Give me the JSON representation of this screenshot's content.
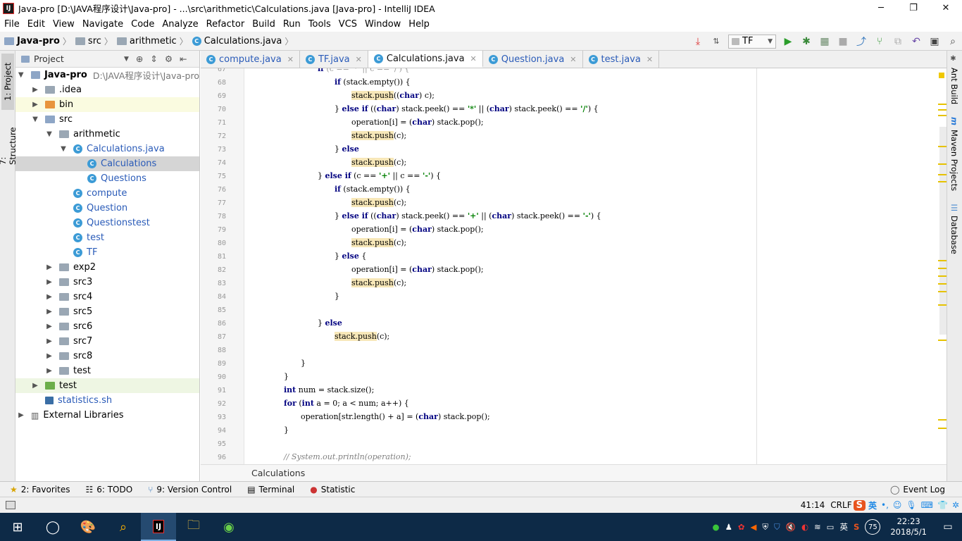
{
  "window": {
    "title": "Java-pro [D:\\JAVA程序设计\\Java-pro] - ...\\src\\arithmetic\\Calculations.java [Java-pro] - IntelliJ IDEA",
    "app_icon": "IJ",
    "min": "─",
    "max": "❐",
    "close": "✕"
  },
  "menu": [
    "File",
    "Edit",
    "View",
    "Navigate",
    "Code",
    "Analyze",
    "Refactor",
    "Build",
    "Run",
    "Tools",
    "VCS",
    "Window",
    "Help"
  ],
  "nav": {
    "crumbs": [
      "Java-pro",
      "src",
      "arithmetic",
      "Calculations.java"
    ],
    "run_config": "TF"
  },
  "left_strip": {
    "project": "1: Project",
    "structure": "7: Structure"
  },
  "right_strip": {
    "ant": "Ant Build",
    "maven": "Maven Projects",
    "database": "Database",
    "maven_icon": "m"
  },
  "project_panel": {
    "header": "Project",
    "tree": [
      {
        "label": "Java-pro",
        "path": "D:\\JAVA程序设计\\Java-pro",
        "arrow": "▼"
      },
      {
        "label": ".idea",
        "arrow": "▶"
      },
      {
        "label": "bin",
        "arrow": "▶"
      },
      {
        "label": "src",
        "arrow": "▼"
      },
      {
        "label": "arithmetic",
        "arrow": "▼"
      },
      {
        "label": "Calculations.java",
        "arrow": "▼"
      },
      {
        "label": "Calculations",
        "arrow": ""
      },
      {
        "label": "Questions",
        "arrow": ""
      },
      {
        "label": "compute",
        "arrow": ""
      },
      {
        "label": "Question",
        "arrow": ""
      },
      {
        "label": "Questionstest",
        "arrow": ""
      },
      {
        "label": "test",
        "arrow": ""
      },
      {
        "label": "TF",
        "arrow": ""
      },
      {
        "label": "exp2",
        "arrow": "▶"
      },
      {
        "label": "src3",
        "arrow": "▶"
      },
      {
        "label": "src4",
        "arrow": "▶"
      },
      {
        "label": "src5",
        "arrow": "▶"
      },
      {
        "label": "src6",
        "arrow": "▶"
      },
      {
        "label": "src7",
        "arrow": "▶"
      },
      {
        "label": "src8",
        "arrow": "▶"
      },
      {
        "label": "test",
        "arrow": "▶"
      },
      {
        "label": "test",
        "arrow": "▶"
      },
      {
        "label": "statistics.sh",
        "arrow": ""
      },
      {
        "label": "External Libraries",
        "arrow": "▶"
      }
    ]
  },
  "tabs": [
    {
      "label": "compute.java",
      "close": "✕"
    },
    {
      "label": "TF.java",
      "close": "✕"
    },
    {
      "label": "Calculations.java",
      "close": "✕"
    },
    {
      "label": "Question.java",
      "close": "✕"
    },
    {
      "label": "test.java",
      "close": "✕"
    }
  ],
  "line_numbers": [
    "67",
    "68",
    "69",
    "70",
    "71",
    "72",
    "73",
    "74",
    "75",
    "76",
    "77",
    "78",
    "79",
    "80",
    "81",
    "82",
    "83",
    "84",
    "85",
    "86",
    "87",
    "88",
    "89",
    "90",
    "91",
    "92",
    "93",
    "94",
    "95",
    "96"
  ],
  "bottom_breadcrumb": "Calculations",
  "tool_windows": [
    {
      "label": "2: Favorites",
      "icon": "★"
    },
    {
      "label": "6: TODO",
      "icon": "☷"
    },
    {
      "label": "9: Version Control",
      "icon": "⑂"
    },
    {
      "label": "Terminal",
      "icon": "▤"
    },
    {
      "label": "Statistic",
      "icon": "●"
    }
  ],
  "event_log": "Event Log",
  "status": {
    "position": "41:14",
    "crlf": "CRLF",
    "ime": "英"
  },
  "taskbar": {
    "time": "22:23",
    "date": "2018/5/1",
    "battery_badge": "75",
    "lang": "英"
  },
  "colors": {
    "accent": "#2a5bb8",
    "highlight": "#f7e7b8",
    "taskbar": "#0d2a47"
  }
}
